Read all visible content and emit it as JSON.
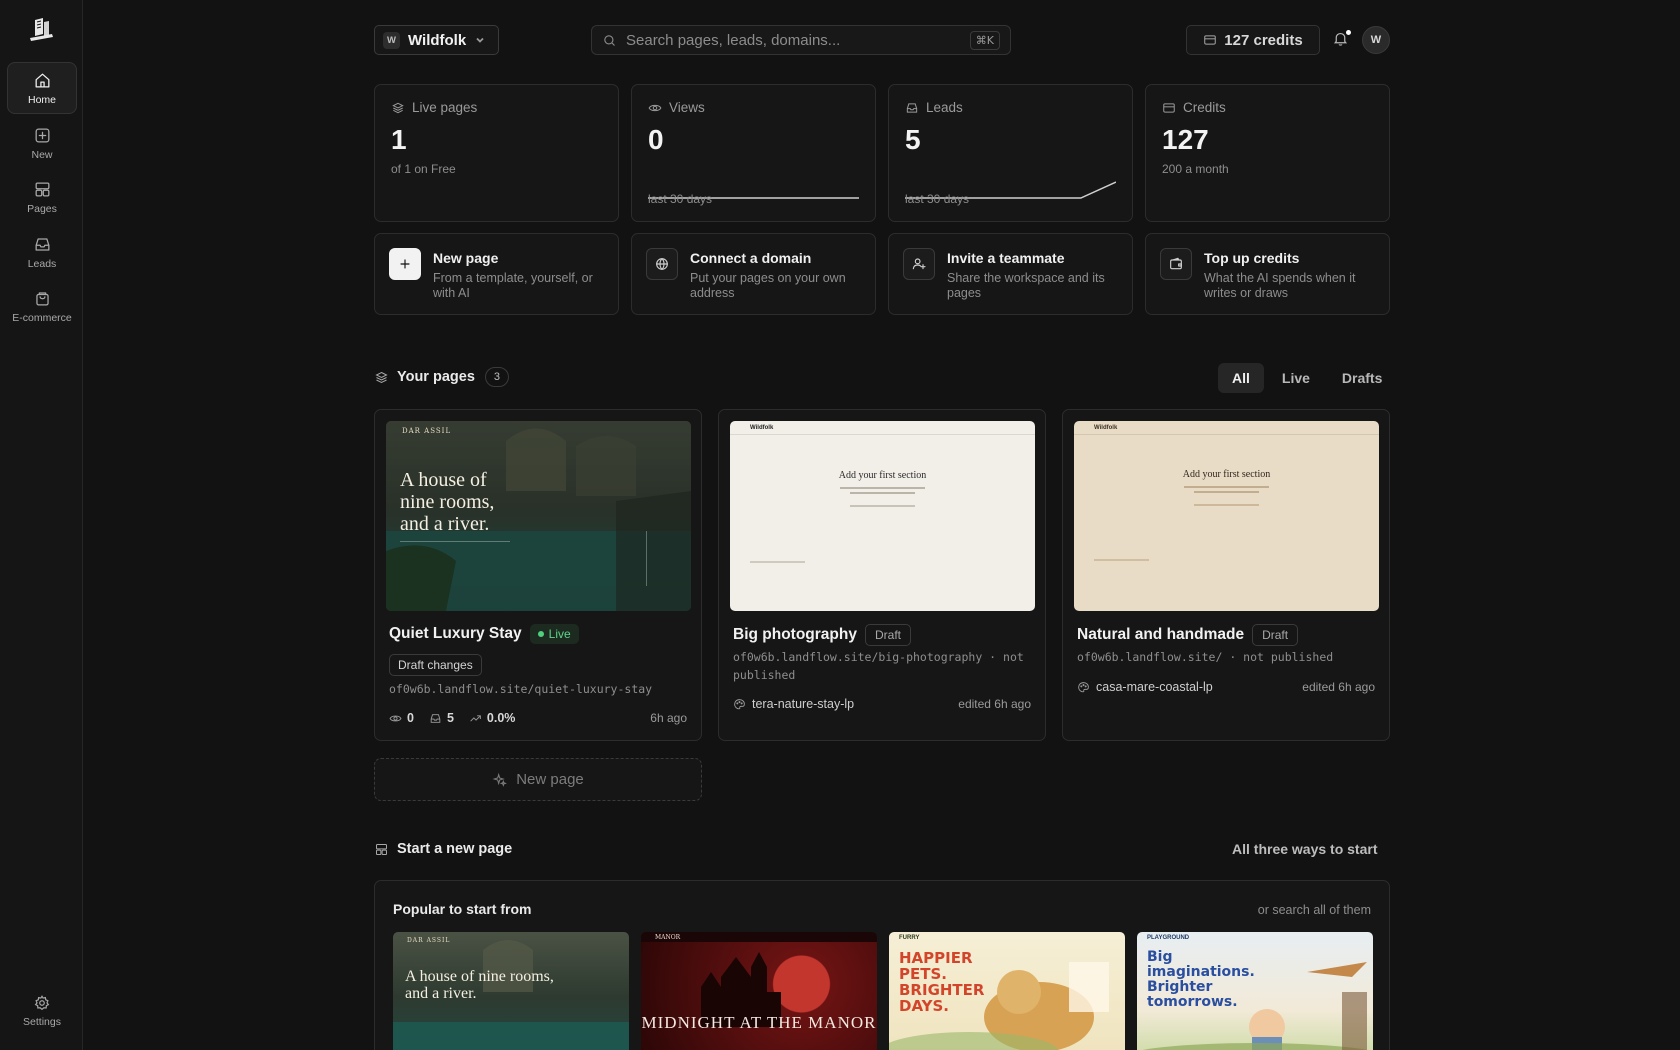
{
  "sidebar": {
    "items": [
      {
        "label": "Home"
      },
      {
        "label": "New"
      },
      {
        "label": "Pages"
      },
      {
        "label": "Leads"
      },
      {
        "label": "E-commerce"
      }
    ],
    "settings_label": "Settings"
  },
  "topbar": {
    "workspace_initial": "W",
    "workspace_name": "Wildfolk",
    "search_placeholder": "Search pages, leads, domains...",
    "search_shortcut": "⌘K",
    "credits_label": "127 credits",
    "avatar_initial": "W"
  },
  "stats": [
    {
      "label": "Live pages",
      "value": "1",
      "sub": "of 1 on Free"
    },
    {
      "label": "Views",
      "value": "0",
      "sub": "last 30 days",
      "trend": [
        0,
        0,
        0,
        0,
        0,
        0,
        0
      ]
    },
    {
      "label": "Leads",
      "value": "5",
      "sub": "last 30 days",
      "trend": [
        0,
        0,
        0,
        0,
        0,
        0,
        5
      ]
    },
    {
      "label": "Credits",
      "value": "127",
      "sub": "200 a month"
    }
  ],
  "actions": [
    {
      "title": "New page",
      "desc": "From a template, yourself, or with AI"
    },
    {
      "title": "Connect a domain",
      "desc": "Put your pages on your own address"
    },
    {
      "title": "Invite a teammate",
      "desc": "Share the workspace and its pages"
    },
    {
      "title": "Top up credits",
      "desc": "What the AI spends when it writes or draws"
    }
  ],
  "your_pages": {
    "title": "Your pages",
    "count": "3",
    "filters": [
      "All",
      "Live",
      "Drafts"
    ],
    "active_filter": "All",
    "cards": [
      {
        "title": "Quiet Luxury Stay",
        "status": "Live",
        "chip": "Draft changes",
        "url": "of0w6b.landflow.site/quiet-luxury-stay",
        "views": "0",
        "leads": "5",
        "conversion": "0.0%",
        "time": "6h ago",
        "thumb": {
          "brand": "DAR ASSIL",
          "headline": "A house of nine rooms, and a river."
        }
      },
      {
        "title": "Big photography",
        "status": "Draft",
        "url": "of0w6b.landflow.site/big-photography · not published",
        "template": "tera-nature-stay-lp",
        "time": "edited 6h ago",
        "thumb": {
          "brand": "Wildfolk",
          "headline": "Add your first section"
        }
      },
      {
        "title": "Natural and handmade",
        "status": "Draft",
        "url": "of0w6b.landflow.site/ · not published",
        "template": "casa-mare-coastal-lp",
        "time": "edited 6h ago",
        "thumb": {
          "brand": "Wildfolk",
          "headline": "Add your first section"
        }
      }
    ],
    "new_page_label": "New page"
  },
  "start": {
    "title": "Start a new page",
    "all_ways_label": "All three ways to start",
    "popular_title": "Popular to start from",
    "search_link": "or search all of them",
    "templates": [
      {
        "brand": "DAR ASSIL",
        "headline": "A house of nine rooms, and a river."
      },
      {
        "brand": "MANOR",
        "headline": "MIDNIGHT AT THE MANOR"
      },
      {
        "brand": "FURRY",
        "headline": "HAPPIER PETS. BRIGHTER DAYS."
      },
      {
        "brand": "PLAYGROUND",
        "headline": "Big imaginations. Brighter tomorrows."
      }
    ]
  },
  "colors": {
    "accent_live": "#4ed07e",
    "background": "#121212",
    "card": "#161616"
  }
}
